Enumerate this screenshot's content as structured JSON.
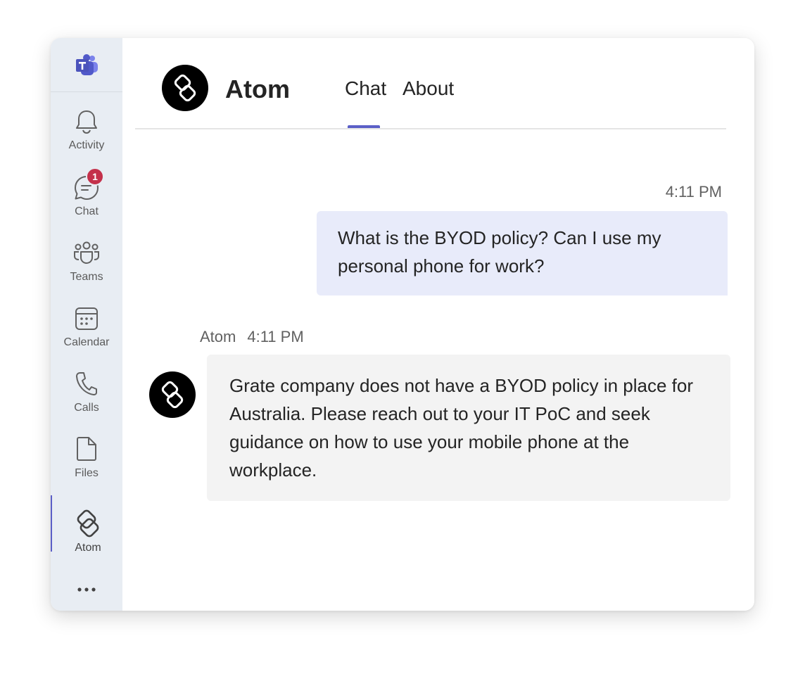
{
  "app": {
    "name": "Microsoft Teams"
  },
  "rail": {
    "items": [
      {
        "label": "Activity",
        "icon": "bell-icon"
      },
      {
        "label": "Chat",
        "icon": "chat-icon",
        "badge": "1"
      },
      {
        "label": "Teams",
        "icon": "teams-icon"
      },
      {
        "label": "Calendar",
        "icon": "calendar-icon"
      },
      {
        "label": "Calls",
        "icon": "phone-icon"
      },
      {
        "label": "Files",
        "icon": "file-icon"
      },
      {
        "label": "Atom",
        "icon": "atom-icon",
        "active": true
      }
    ],
    "more_icon": "more-dots-icon"
  },
  "header": {
    "title": "Atom",
    "tabs": [
      {
        "label": "Chat",
        "active": true
      },
      {
        "label": "About",
        "active": false
      }
    ]
  },
  "messages": [
    {
      "from": "me",
      "time": "4:11 PM",
      "text": "What is the BYOD policy? Can I use my personal phone for work?"
    },
    {
      "from": "bot",
      "sender": "Atom",
      "time": "4:11 PM",
      "text": "Grate company does not have a BYOD policy in place for Australia. Please reach out to your IT PoC and seek guidance on how to use your mobile phone at the workplace."
    }
  ],
  "colors": {
    "accent": "#5b5fc7",
    "rail_bg": "#e8edf3",
    "my_bubble": "#e8ebfa",
    "bot_bubble": "#f3f3f3",
    "badge": "#c4314b"
  }
}
